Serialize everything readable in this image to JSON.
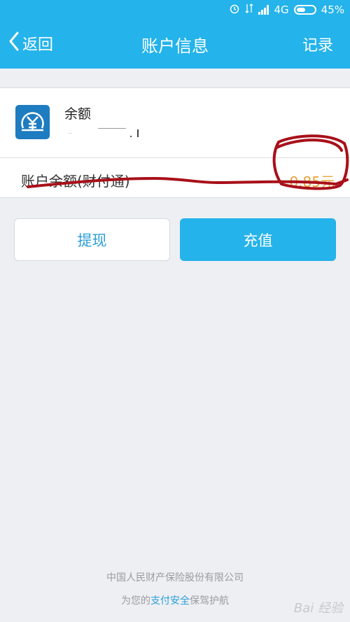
{
  "status": {
    "network": "4G",
    "battery": "45%"
  },
  "nav": {
    "back": "返回",
    "title": "账户信息",
    "right": "记录"
  },
  "account": {
    "icon": "yuan-coin-icon",
    "name": "余额",
    "balance_label": "账户余额(财付通)",
    "balance_value": "0.85元"
  },
  "buttons": {
    "withdraw": "提现",
    "recharge": "充值"
  },
  "footer": {
    "line1": "中国人民财产保险股份有限公司",
    "line2_pre": "为您的",
    "line2_hl": "支付安全",
    "line2_post": "保驾护航"
  },
  "watermark": "Bai 经验",
  "colors": {
    "primary": "#24b3ea",
    "balance": "#e8a23a",
    "icon_bg": "#1e7cc0",
    "annotation": "#a8101a"
  }
}
